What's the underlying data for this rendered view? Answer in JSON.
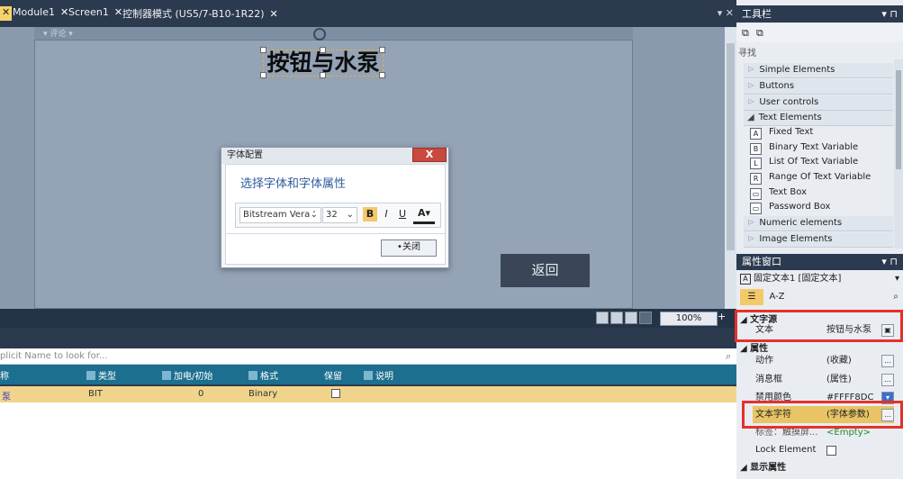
{
  "tabs": [
    {
      "label": "Module1",
      "active": false
    },
    {
      "label": "Screen1",
      "active": false
    },
    {
      "label": "控制器模式 (US5/7-B10-1R22)",
      "active": false
    }
  ],
  "canvas": {
    "ruler_label": "▾ 评论 ▾",
    "title_text": "按钮与水泵",
    "back_button": "返回"
  },
  "dialog": {
    "title": "字体配置",
    "close_glyph": "X",
    "heading": "选择字体和字体属性",
    "font_name": "Bitstream Vera ’",
    "font_size": "32",
    "bold": "B",
    "italic": "I",
    "underline": "U",
    "color_a": "A",
    "close_button": "•关闭"
  },
  "statusbar": {
    "zoom": "100%"
  },
  "bottom": {
    "search_placeholder": "plicit Name to look for...",
    "columns": [
      "称",
      "类型",
      "加电/初始",
      "格式",
      "保留",
      "说明"
    ],
    "row": {
      "name": "泵",
      "type": "BIT",
      "init": "0",
      "format": "Binary"
    }
  },
  "toolbox": {
    "title": "工具栏",
    "search_label": "寻找",
    "categories": [
      "Simple Elements",
      "Buttons",
      "User controls",
      "Text Elements",
      "Numeric elements",
      "Image Elements"
    ],
    "text_tools": [
      "Fixed Text",
      "Binary Text Variable",
      "List Of Text Variable",
      "Range Of Text Variable",
      "Text Box",
      "Password Box"
    ]
  },
  "properties": {
    "title": "属性窗口",
    "object": "固定文本1 [固定文本]",
    "sort_az": "A-Z",
    "sections": {
      "text_source": "文字源",
      "attributes": "属性",
      "display": "显示属性"
    },
    "rows": [
      {
        "label": "文本",
        "value": "按钮与水泵"
      },
      {
        "label": "动作",
        "value": "(收藏)"
      },
      {
        "label": "消息框",
        "value": "(属性)"
      },
      {
        "label": "禁用颜色",
        "value": "#FFFF8DC"
      },
      {
        "label": "文本字符",
        "value": "(字体参数)"
      },
      {
        "label": "标签：触摸屏...",
        "value": "<Empty>"
      },
      {
        "label": "Lock Element",
        "value": ""
      }
    ]
  },
  "colors": {
    "accent": "#f5d36b",
    "highlight": "#e5312b",
    "header": "#2b3a4f"
  }
}
